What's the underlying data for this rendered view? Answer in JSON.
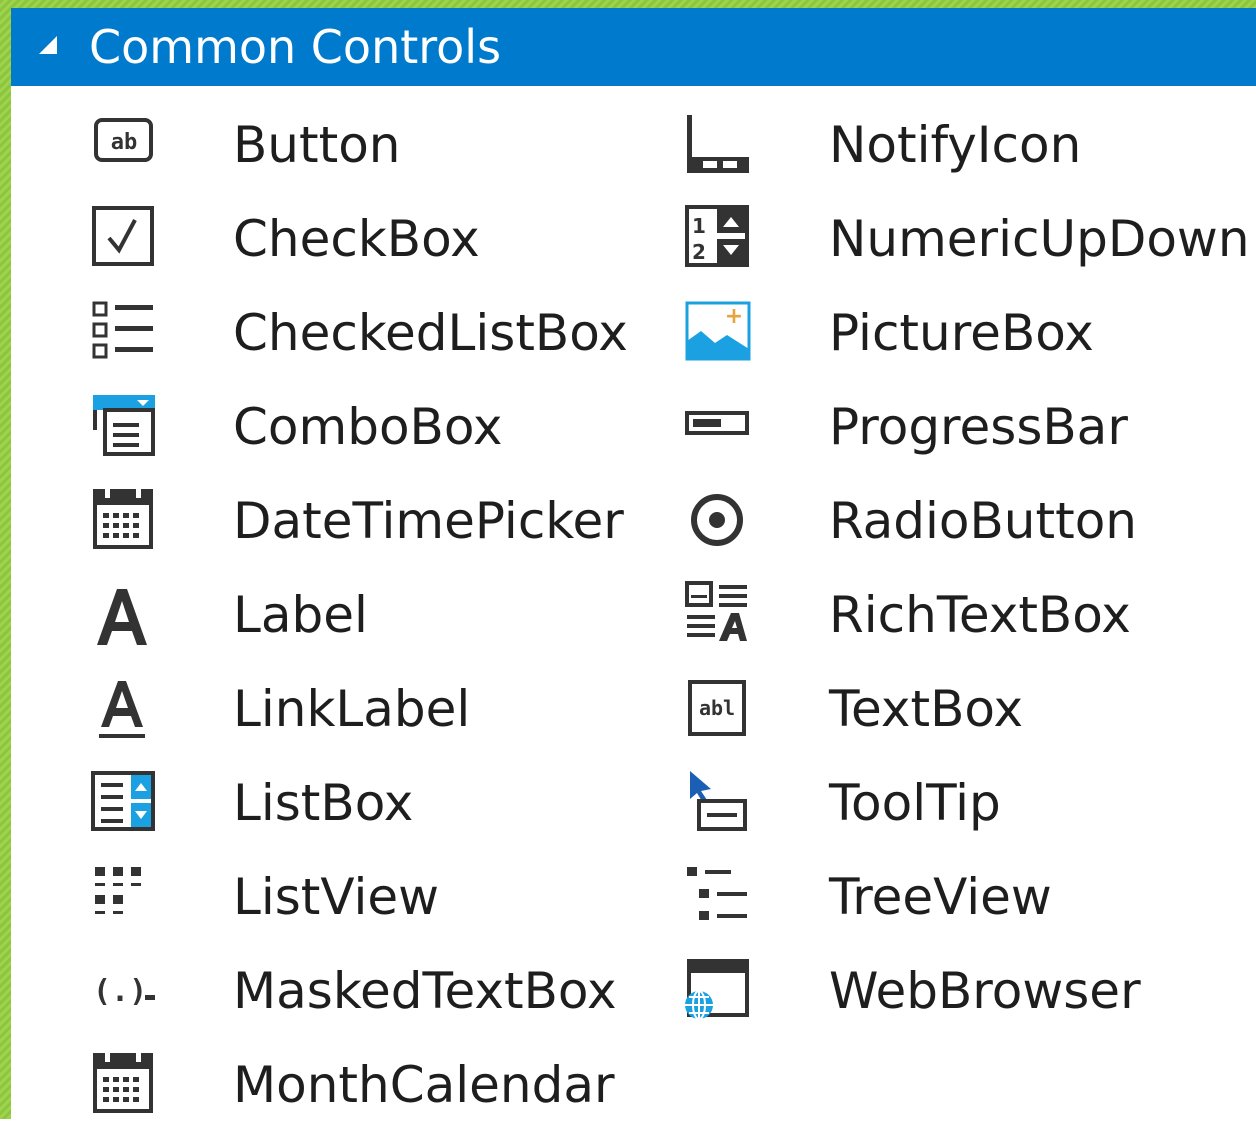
{
  "toolbox": {
    "section_title": "Common Controls",
    "expand_icon": "collapse-triangle-icon",
    "column1": [
      {
        "label": "Button",
        "icon": "button-icon"
      },
      {
        "label": "CheckBox",
        "icon": "checkbox-icon"
      },
      {
        "label": "CheckedListBox",
        "icon": "checkedlistbox-icon"
      },
      {
        "label": "ComboBox",
        "icon": "combobox-icon"
      },
      {
        "label": "DateTimePicker",
        "icon": "datetimepicker-icon"
      },
      {
        "label": "Label",
        "icon": "label-icon"
      },
      {
        "label": "LinkLabel",
        "icon": "linklabel-icon"
      },
      {
        "label": "ListBox",
        "icon": "listbox-icon"
      },
      {
        "label": "ListView",
        "icon": "listview-icon"
      },
      {
        "label": "MaskedTextBox",
        "icon": "maskedtextbox-icon"
      },
      {
        "label": "MonthCalendar",
        "icon": "monthcalendar-icon"
      }
    ],
    "column2": [
      {
        "label": "NotifyIcon",
        "icon": "notifyicon-icon"
      },
      {
        "label": "NumericUpDown",
        "icon": "numericupdown-icon"
      },
      {
        "label": "PictureBox",
        "icon": "picturebox-icon"
      },
      {
        "label": "ProgressBar",
        "icon": "progressbar-icon"
      },
      {
        "label": "RadioButton",
        "icon": "radiobutton-icon"
      },
      {
        "label": "RichTextBox",
        "icon": "richtextbox-icon"
      },
      {
        "label": "TextBox",
        "icon": "textbox-icon"
      },
      {
        "label": "ToolTip",
        "icon": "tooltip-icon"
      },
      {
        "label": "TreeView",
        "icon": "treeview-icon"
      },
      {
        "label": "WebBrowser",
        "icon": "webbrowser-icon"
      }
    ],
    "colors": {
      "header_bg": "#007acc",
      "header_text": "#ffffff",
      "item_text": "#1e1e1e",
      "icon_accent": "#1ba1e2",
      "frame": "#8cc63f"
    }
  },
  "icon_glyphs": {
    "button_text": "ab",
    "textbox_text": "abl",
    "numeric_top": "1",
    "numeric_bottom": "2",
    "masked_text": "(.)",
    "plus": "+"
  }
}
